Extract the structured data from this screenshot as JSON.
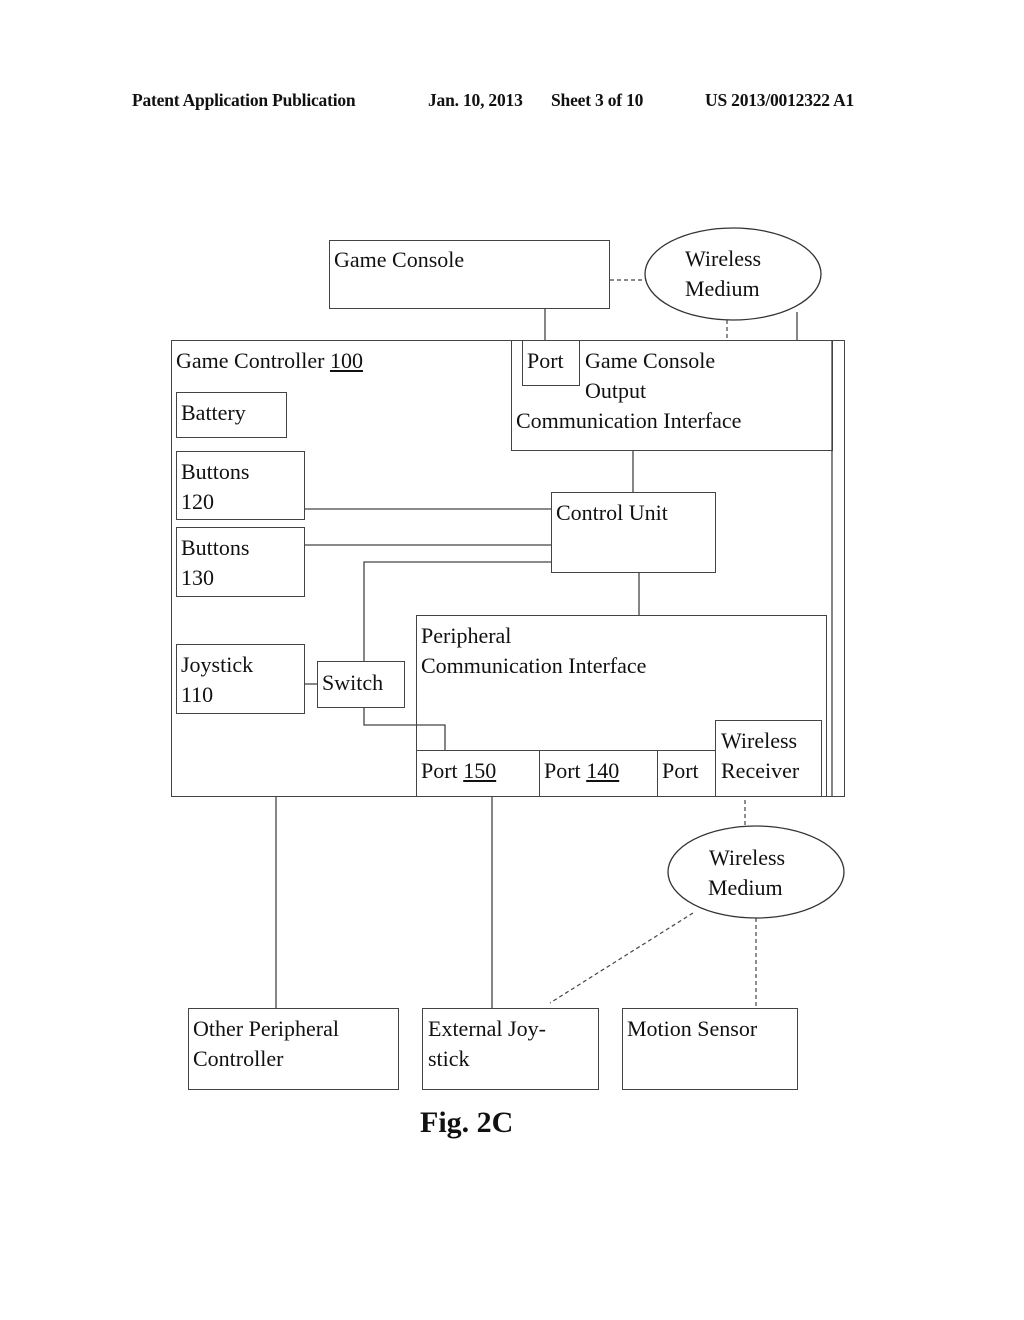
{
  "header": {
    "publication_type": "Patent Application Publication",
    "date": "Jan. 10, 2013",
    "sheet": "Sheet 3 of 10",
    "publication_number": "US 2013/0012322 A1"
  },
  "diagram": {
    "game_console": "Game Console",
    "wireless_medium_top": {
      "line1": "Wireless",
      "line2": "Medium"
    },
    "game_controller": {
      "label": "Game Controller ",
      "ref": "100"
    },
    "battery": "Battery",
    "buttons_120": {
      "line1": "Buttons",
      "line2": "120"
    },
    "buttons_130": {
      "line1": "Buttons",
      "line2": "130"
    },
    "joystick_110": {
      "line1": "Joystick",
      "line2": "110"
    },
    "switch": "Switch",
    "control_unit": "Control Unit",
    "output_interface": {
      "port": "Port",
      "line1": "Game Console",
      "line2": "Output",
      "line3": "Communication Interface"
    },
    "peripheral_interface": {
      "line1": "Peripheral",
      "line2": "Communication Interface"
    },
    "port_150": {
      "label": "Port ",
      "ref": "150"
    },
    "port_140": {
      "label": "Port ",
      "ref": "140"
    },
    "port_plain": "Port",
    "wireless_receiver": {
      "line1": "Wireless",
      "line2": "Receiver"
    },
    "wireless_medium_bottom": {
      "line1": "Wireless",
      "line2": "Medium"
    },
    "other_peripheral": {
      "line1": "Other Peripheral",
      "line2": "Controller"
    },
    "external_joystick": {
      "line1": "External Joy-",
      "line2": "stick"
    },
    "motion_sensor": "Motion Sensor"
  },
  "figure_label": "Fig. 2C"
}
